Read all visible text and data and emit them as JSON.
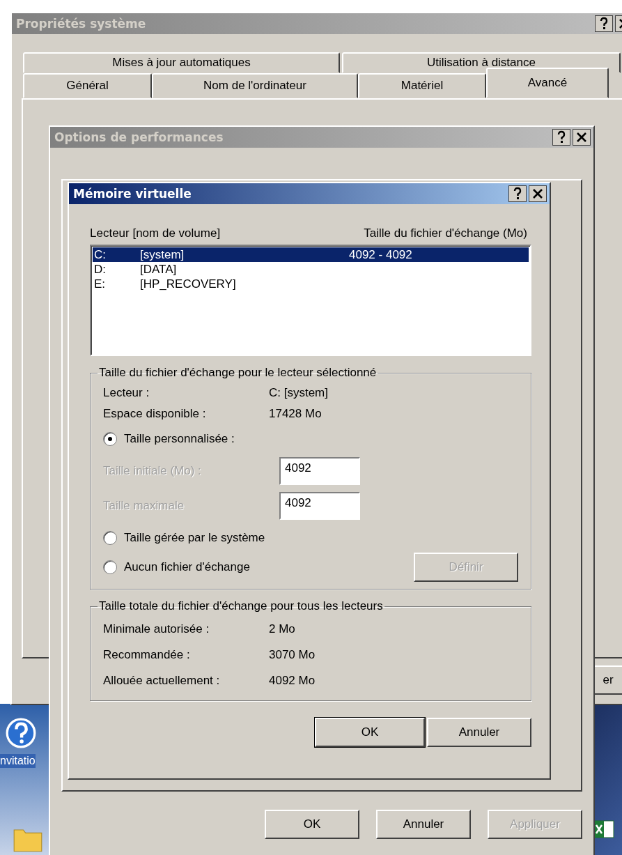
{
  "system_window": {
    "title": "Propriétés système",
    "active": false,
    "tabs_row1": [
      {
        "label": "Mises à jour automatiques",
        "selected": false
      },
      {
        "label": "Utilisation à distance",
        "selected": false
      }
    ],
    "tabs_row2": [
      {
        "label": "Général",
        "selected": false
      },
      {
        "label": "Nom de l'ordinateur",
        "selected": false
      },
      {
        "label": "Matériel",
        "selected": false
      },
      {
        "label": "Avancé",
        "selected": true
      }
    ],
    "button_fragment": "er"
  },
  "performance_window": {
    "title": "Options de performances",
    "active": false,
    "buttons": [
      {
        "label": "OK",
        "disabled": false
      },
      {
        "label": "Annuler",
        "disabled": false
      },
      {
        "label": "Appliquer",
        "disabled": true
      }
    ]
  },
  "virtual_memory_window": {
    "title": "Mémoire virtuelle",
    "active": true,
    "columns": [
      "Lecteur [nom de volume]",
      "Taille du fichier d'échange (Mo)"
    ],
    "drives": [
      {
        "letter": "C:",
        "volume": "[system]",
        "size": "4092 - 4092",
        "selected": true
      },
      {
        "letter": "D:",
        "volume": "[DATA]",
        "selected": false
      },
      {
        "letter": "E:",
        "volume": "[HP_RECOVERY]",
        "selected": false
      }
    ],
    "drive_group": {
      "title": "Taille du fichier d'échange pour le lecteur sélectionné",
      "info": [
        {
          "label": "Lecteur :",
          "value": "C:  [system]"
        },
        {
          "label": "Espace disponible :",
          "value": "17428 Mo"
        }
      ],
      "options": [
        {
          "label": "Taille personnalisée :",
          "selected": true
        },
        {
          "label": "Taille gérée par le système",
          "selected": false
        },
        {
          "label": "Aucun fichier d'échange",
          "selected": false
        }
      ],
      "fields": [
        {
          "label": "Taille initiale (Mo) :",
          "value": "4092",
          "label_disabled": true
        },
        {
          "label": "Taille maximale",
          "value": "4092",
          "label_disabled": true
        }
      ],
      "set_button": {
        "label": "Définir",
        "disabled": true
      }
    },
    "total_group": {
      "title": "Taille totale du fichier d'échange pour tous les lecteurs",
      "rows": [
        {
          "label": "Minimale autorisée :",
          "value": "2 Mo"
        },
        {
          "label": "Recommandée :",
          "value": "3070 Mo"
        },
        {
          "label": "Allouée actuellement :",
          "value": "4092 Mo"
        }
      ]
    },
    "buttons": [
      {
        "label": "OK",
        "default": true
      },
      {
        "label": "Annuler",
        "default": false
      }
    ]
  },
  "desktop": {
    "icons": [
      {
        "kind": "help",
        "label": "nvitatio"
      },
      {
        "kind": "folder"
      },
      {
        "kind": "spreadsheet"
      }
    ]
  }
}
